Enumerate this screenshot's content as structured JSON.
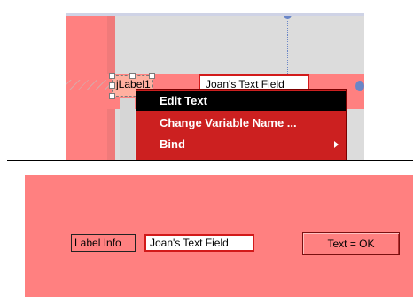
{
  "designer": {
    "label_text": "jLabel1",
    "text_field_value": "Joan's Text Field",
    "context_menu": {
      "items": [
        {
          "label": "Edit Text",
          "has_submenu": false,
          "highlighted": true
        },
        {
          "label": "Change Variable Name ...",
          "has_submenu": false,
          "highlighted": false
        },
        {
          "label": "Bind",
          "has_submenu": true,
          "highlighted": false
        }
      ]
    }
  },
  "runtime": {
    "label_text": "Label Info",
    "text_field_value": "Joan's Text Field",
    "button_label": "Text = OK"
  },
  "colors": {
    "panel_background": "#ff8080",
    "menu_background": "#cc2020",
    "menu_highlight": "#000000",
    "designer_background": "#dcdcdc",
    "field_border": "#d21a1a"
  },
  "icons": {
    "submenu_arrow": "chevron-right-icon",
    "guide_dot": "anchor-dot-icon"
  }
}
